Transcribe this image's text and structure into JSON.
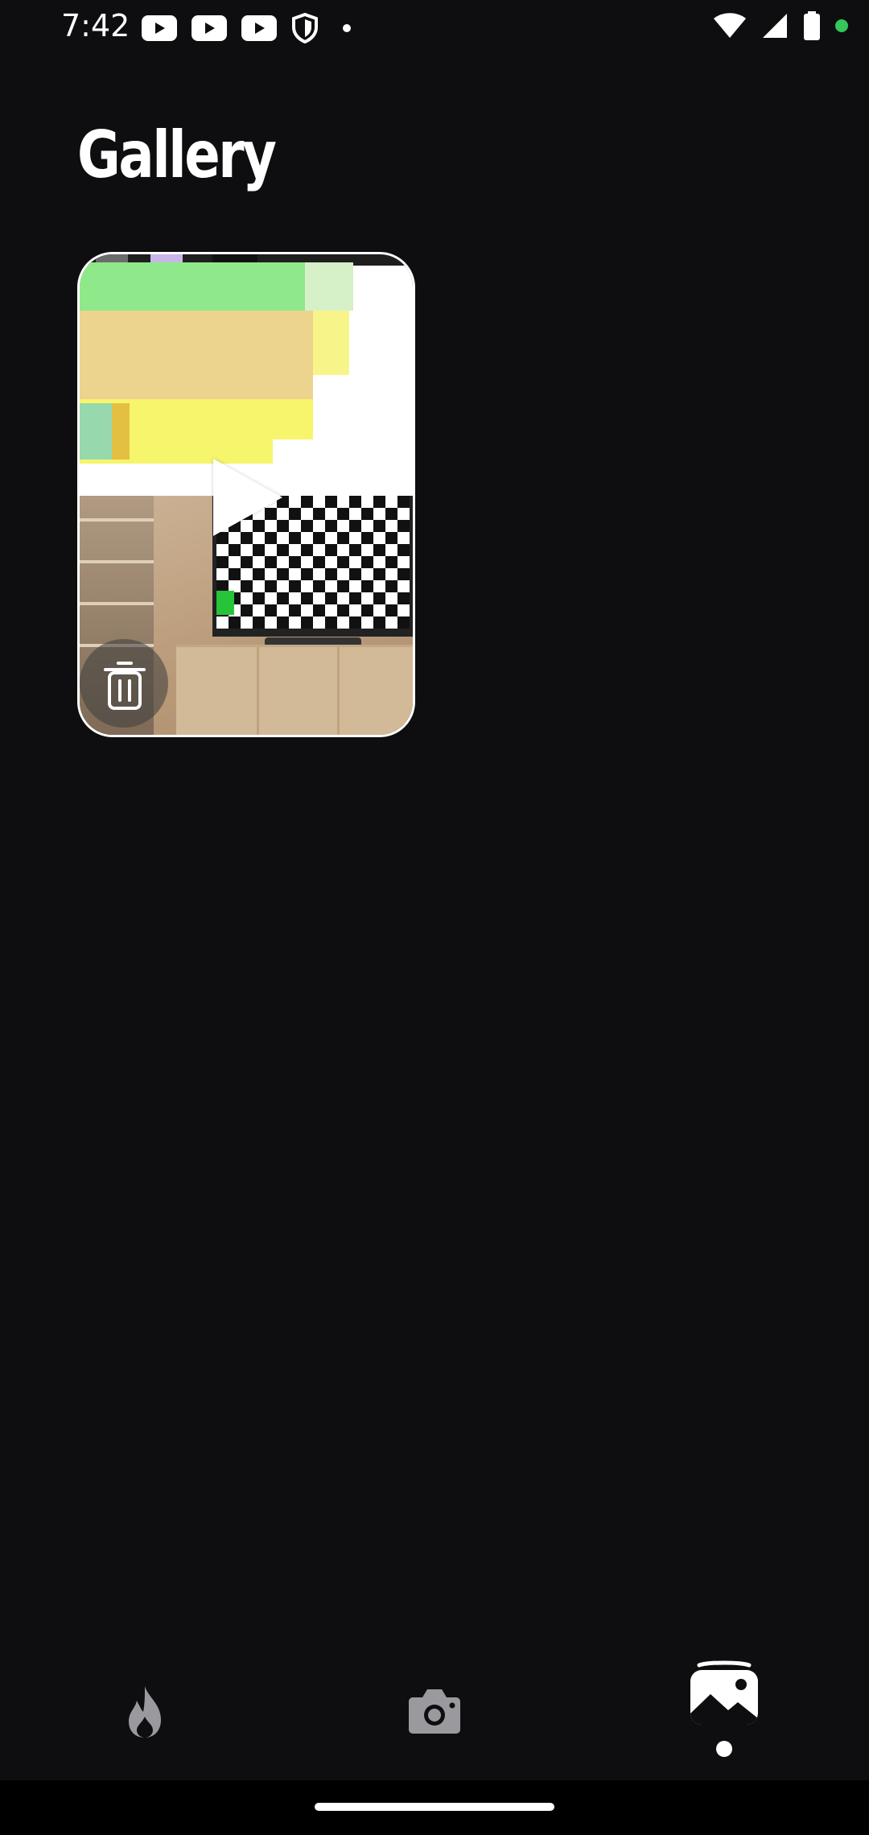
{
  "status_bar": {
    "time": "7:42",
    "left_icons": [
      "youtube-icon",
      "youtube-icon",
      "youtube-icon",
      "shield-icon",
      "notification-dot"
    ],
    "right_icons": [
      "wifi-icon",
      "signal-icon",
      "battery-icon",
      "green-dot"
    ]
  },
  "page": {
    "title": "Gallery"
  },
  "gallery": {
    "items": [
      {
        "type": "video",
        "play_icon": "play-icon",
        "delete_icon": "trash-icon"
      }
    ]
  },
  "bottom_nav": {
    "items": [
      {
        "icon": "flame-icon",
        "selected": false
      },
      {
        "icon": "camera-icon",
        "selected": false
      },
      {
        "icon": "gallery-icon",
        "selected": true
      }
    ]
  },
  "colors": {
    "background": "#0e0e11",
    "accent_green": "#34c759"
  }
}
